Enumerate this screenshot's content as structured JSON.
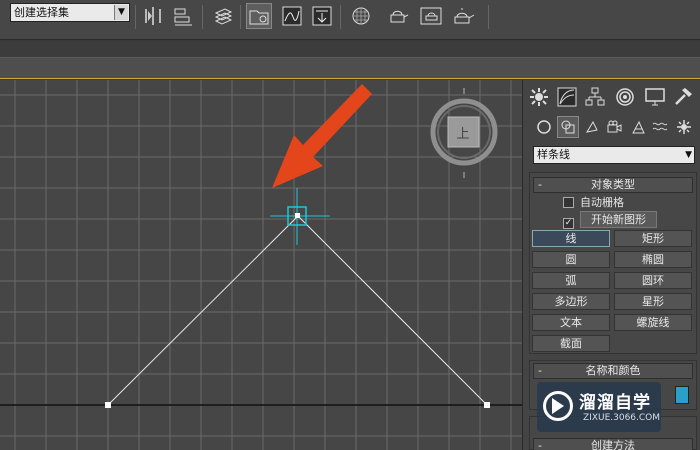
{
  "toolbar": {
    "selection_set_value": "创建选择集",
    "icons": [
      "mirror-icon",
      "align-icon",
      "layer-manager-icon",
      "scene-explorer-icon",
      "curve-editor-icon",
      "schematic-view-icon",
      "material-editor-icon",
      "render-setup-icon",
      "rendered-frame-icon",
      "render-icon"
    ]
  },
  "viewport": {
    "label": "viewport-perspective",
    "nav_cube_face": "上",
    "colors": {
      "background": "#464646",
      "grid": "#6a6a6a",
      "spline": "#e8e8e8",
      "cursor": "#19c8d8",
      "arrow": "#e5451a"
    }
  },
  "command_panel": {
    "tabs": [
      "create-tab",
      "modify-tab",
      "hierarchy-tab",
      "motion-tab",
      "display-tab",
      "utilities-tab"
    ],
    "subcategory_icons": [
      "geometry-icon",
      "shapes-icon",
      "lights-icon",
      "cameras-icon",
      "helpers-icon",
      "space-warps-icon",
      "systems-icon"
    ],
    "category_value": "样条线",
    "object_type": {
      "title": "对象类型",
      "auto_grid_label": "自动栅格",
      "start_new_shape_label": "开始新图形",
      "buttons": [
        "线",
        "矩形",
        "圆",
        "椭圆",
        "弧",
        "圆环",
        "多边形",
        "星形",
        "文本",
        "螺旋线",
        "截面"
      ]
    },
    "name_color": {
      "title": "名称和颜色",
      "swatch_color": "#2aa0c9"
    },
    "creation_method": {
      "title": "创建方法"
    }
  },
  "watermark": {
    "title": "溜溜自学",
    "subtitle": "ZIXUE.3066.COM"
  }
}
